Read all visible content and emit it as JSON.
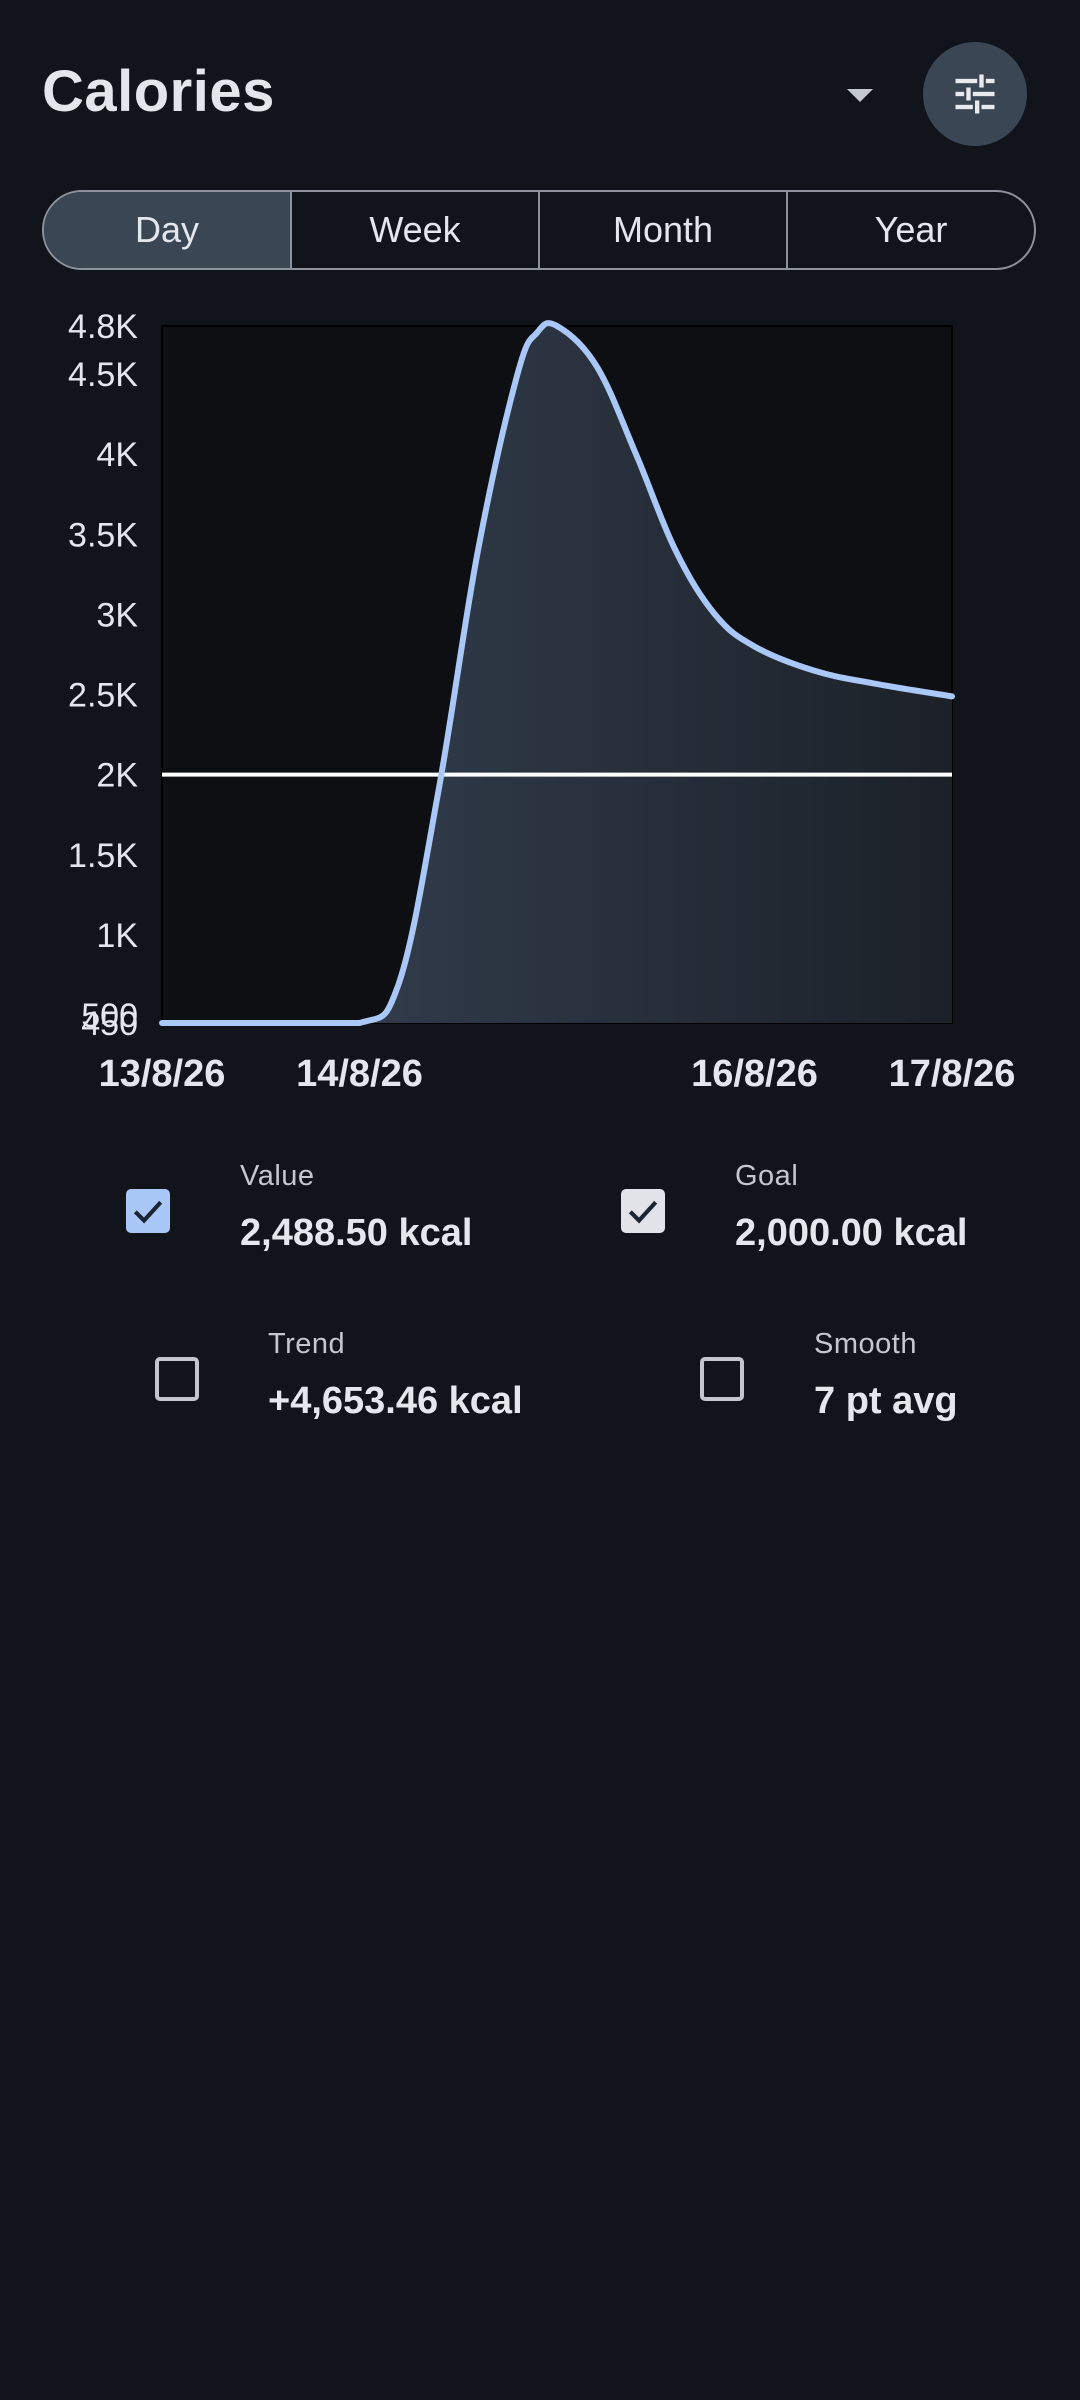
{
  "header": {
    "title": "Calories",
    "dropdown_icon": "arrow-drop-down-icon",
    "settings_icon": "tune-icon"
  },
  "tabs": [
    {
      "label": "Day",
      "active": true
    },
    {
      "label": "Week",
      "active": false
    },
    {
      "label": "Month",
      "active": false
    },
    {
      "label": "Year",
      "active": false
    }
  ],
  "chart_data": {
    "type": "area",
    "y_ticks": [
      "4.8K",
      "4.5K",
      "4K",
      "3.5K",
      "3K",
      "2.5K",
      "2K",
      "1.5K",
      "1K",
      "500",
      "450"
    ],
    "y_tick_values": [
      4800,
      4500,
      4000,
      3500,
      3000,
      2500,
      2000,
      1500,
      1000,
      500,
      450
    ],
    "ylim": [
      450,
      4800
    ],
    "x_ticks": [
      "13/8/26",
      "14/8/26",
      "16/8/26",
      "17/8/26"
    ],
    "x_tick_days": [
      0,
      1,
      3,
      4
    ],
    "xlim": [
      0,
      4
    ],
    "series": [
      {
        "name": "Value",
        "x_days": [
          0,
          0.5,
          1.0,
          1.2,
          1.4,
          1.6,
          1.8,
          1.9,
          2.0,
          2.2,
          2.4,
          2.6,
          2.8,
          3.0,
          3.3,
          3.6,
          4.0
        ],
        "values": [
          450,
          450,
          450,
          700,
          1900,
          3400,
          4500,
          4760,
          4800,
          4550,
          4000,
          3400,
          3000,
          2800,
          2650,
          2570,
          2488.5
        ],
        "color": "#a9c7f7"
      }
    ],
    "goal": {
      "name": "Goal",
      "value": 2000,
      "color": "#ffffff"
    },
    "grid": false
  },
  "legend": [
    {
      "label": "Value",
      "value": "2,488.50 kcal",
      "checked": true,
      "style": "blue"
    },
    {
      "label": "Goal",
      "value": "2,000.00 kcal",
      "checked": true,
      "style": "gray"
    },
    {
      "label": "Trend",
      "value": "+4,653.46 kcal",
      "checked": false,
      "style": "none"
    },
    {
      "label": "Smooth",
      "value": "7 pt avg",
      "checked": false,
      "style": "none"
    }
  ],
  "colors": {
    "background": "#11151b",
    "accent": "#a9c7f7",
    "chip": "#3b4655"
  }
}
